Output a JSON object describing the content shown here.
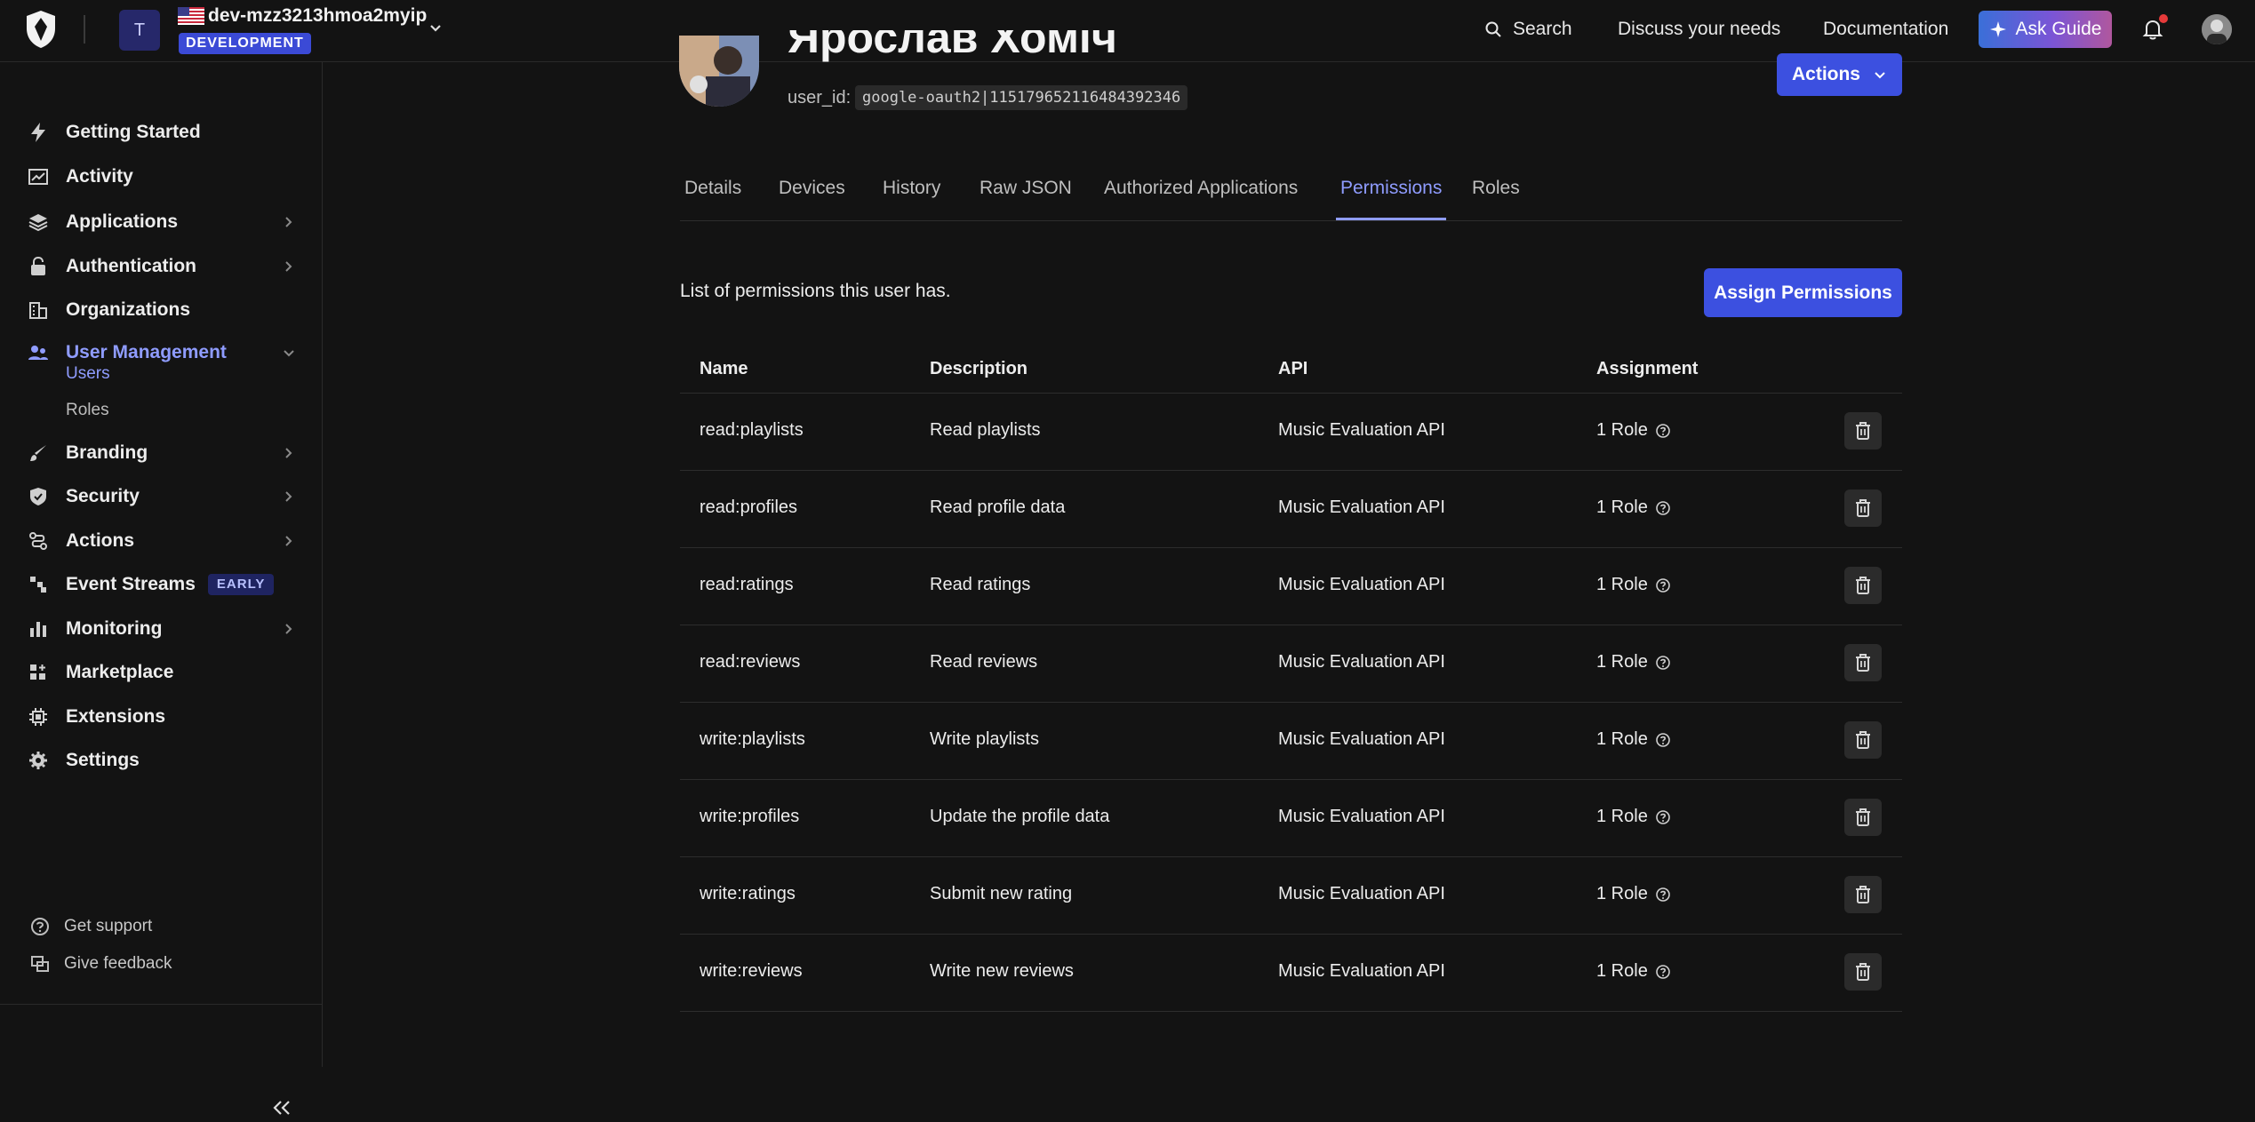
{
  "topbar": {
    "tenant_initial": "T",
    "tenant_name": "dev-mzz3213hmoa2myip",
    "environment": "DEVELOPMENT",
    "search_label": "Search",
    "discuss_label": "Discuss your needs",
    "docs_label": "Documentation",
    "ask_guide_label": "Ask Guide",
    "accent_gradient": [
      "#3a6fd8",
      "#7a55d6",
      "#b0579e"
    ],
    "notification_dot_color": "#e63a3a"
  },
  "sidebar": {
    "items": [
      {
        "label": "Getting Started",
        "icon": "bolt-icon"
      },
      {
        "label": "Activity",
        "icon": "activity-chart-icon"
      },
      {
        "label": "Applications",
        "icon": "layers-icon"
      },
      {
        "label": "Authentication",
        "icon": "lock-icon"
      },
      {
        "label": "Organizations",
        "icon": "building-icon"
      },
      {
        "label": "User Management",
        "icon": "users-icon"
      },
      {
        "label": "Branding",
        "icon": "brush-icon"
      },
      {
        "label": "Security",
        "icon": "shield-icon"
      },
      {
        "label": "Actions",
        "icon": "flow-icon"
      },
      {
        "label": "Event Streams",
        "icon": "stream-icon",
        "badge": "EARLY"
      },
      {
        "label": "Monitoring",
        "icon": "bar-chart-icon"
      },
      {
        "label": "Marketplace",
        "icon": "grid-plus-icon"
      },
      {
        "label": "Extensions",
        "icon": "chip-icon"
      },
      {
        "label": "Settings",
        "icon": "gear-icon"
      }
    ],
    "sub_items": [
      "Users",
      "Roles"
    ],
    "footer": [
      "Get support",
      "Give feedback"
    ],
    "active_color": "#8f9cff"
  },
  "profile": {
    "name": "Ярослав Хоміч",
    "user_id_label": "user_id:",
    "user_id": "google-oauth2|115179652116484392346",
    "actions_label": "Actions"
  },
  "tabs": [
    "Details",
    "Devices",
    "History",
    "Raw JSON",
    "Authorized Applications",
    "Permissions",
    "Roles"
  ],
  "permissions": {
    "description": "List of permissions this user has.",
    "assign_label": "Assign Permissions",
    "columns": [
      "Name",
      "Description",
      "API",
      "Assignment"
    ],
    "rows": [
      {
        "name": "read:playlists",
        "description": "Read playlists",
        "api": "Music Evaluation API",
        "assignment": "1 Role"
      },
      {
        "name": "read:profiles",
        "description": "Read profile data",
        "api": "Music Evaluation API",
        "assignment": "1 Role"
      },
      {
        "name": "read:ratings",
        "description": "Read ratings",
        "api": "Music Evaluation API",
        "assignment": "1 Role"
      },
      {
        "name": "read:reviews",
        "description": "Read reviews",
        "api": "Music Evaluation API",
        "assignment": "1 Role"
      },
      {
        "name": "write:playlists",
        "description": "Write playlists",
        "api": "Music Evaluation API",
        "assignment": "1 Role"
      },
      {
        "name": "write:profiles",
        "description": "Update the profile data",
        "api": "Music Evaluation API",
        "assignment": "1 Role"
      },
      {
        "name": "write:ratings",
        "description": "Submit new rating",
        "api": "Music Evaluation API",
        "assignment": "1 Role"
      },
      {
        "name": "write:reviews",
        "description": "Write new reviews",
        "api": "Music Evaluation API",
        "assignment": "1 Role"
      }
    ]
  },
  "colors": {
    "primary_button": "#3c50e0",
    "background": "#131313"
  }
}
